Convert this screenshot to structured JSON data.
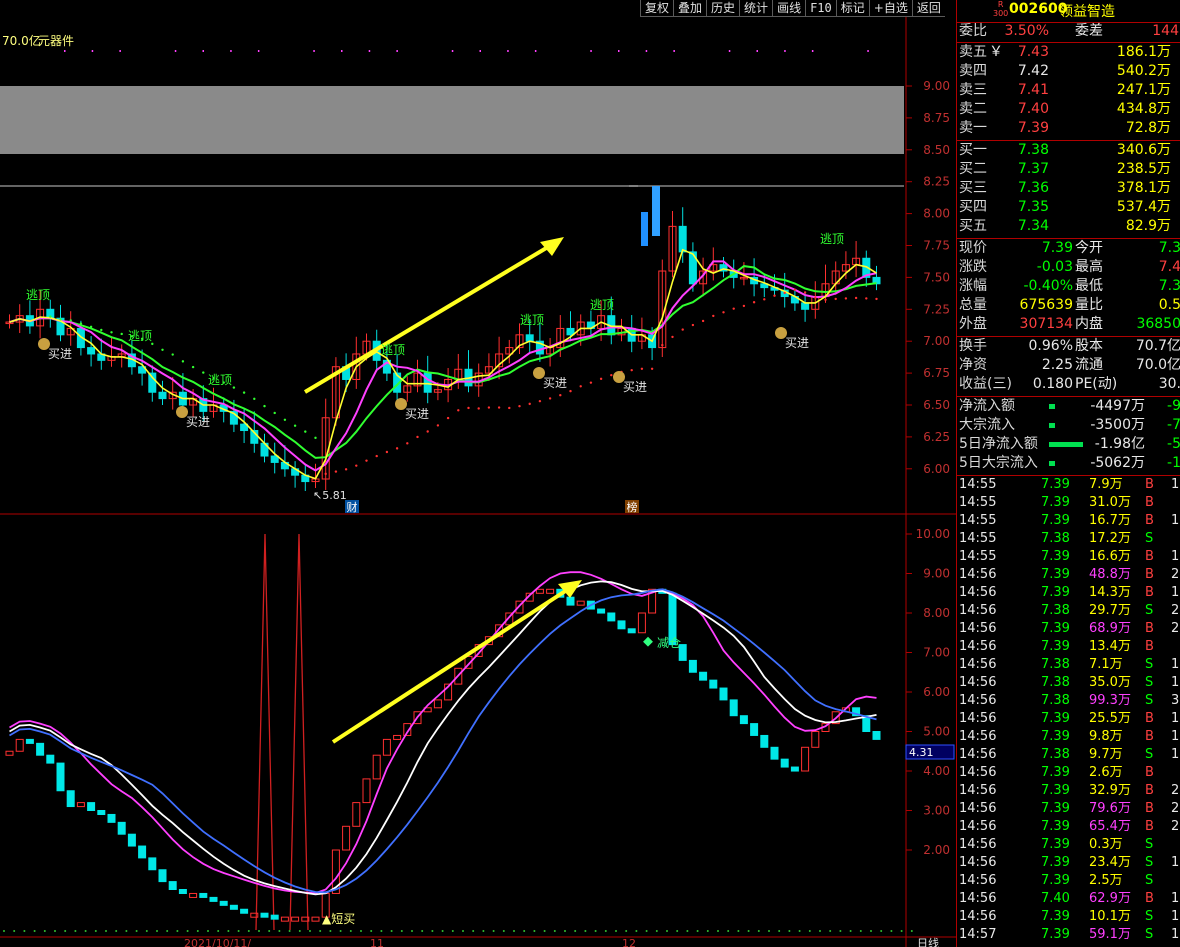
{
  "toolbar": {
    "buttons": [
      "复权",
      "叠加",
      "历史",
      "统计",
      "画线",
      "F10",
      "标记",
      "+自选",
      "返回"
    ]
  },
  "chart": {
    "top_text_a": "70.0亿",
    "top_text_b": "元器件",
    "main_axis": [
      "9.00",
      "8.75",
      "8.50",
      "8.25",
      "8.00",
      "7.75",
      "7.50",
      "7.25",
      "7.00",
      "6.75",
      "6.50",
      "6.25",
      "6.00"
    ],
    "low_label": "5.81",
    "labels": {
      "escape": "逃顶",
      "buy": "买进",
      "short_buy": "▲短买",
      "reduce": "减仓",
      "cai": "财",
      "bang": "榜"
    },
    "sub_axis": [
      "10.00",
      "9.00",
      "8.00",
      "7.00",
      "6.00",
      "5.00",
      "4.00",
      "3.00",
      "2.00"
    ],
    "sub_current": "4.31",
    "date_labels": [
      "2021/10/11/",
      "11",
      "12"
    ],
    "period": "日线"
  },
  "quote": {
    "badge_top": "R",
    "badge_bottom": "300",
    "code": "002600",
    "name": "领益智造",
    "weibi_label": "委比",
    "weibi": "3.50%",
    "weicha_label": "委差",
    "weicha": "144",
    "sell": [
      {
        "label": "卖五",
        "mark": "￥",
        "price": "7.43",
        "vol": "186.1万"
      },
      {
        "label": "卖四",
        "mark": "",
        "price": "7.42",
        "vol": "540.2万"
      },
      {
        "label": "卖三",
        "mark": "",
        "price": "7.41",
        "vol": "247.1万"
      },
      {
        "label": "卖二",
        "mark": "",
        "price": "7.40",
        "vol": "434.8万"
      },
      {
        "label": "卖一",
        "mark": "",
        "price": "7.39",
        "vol": "72.8万"
      }
    ],
    "buy": [
      {
        "label": "买一",
        "price": "7.38",
        "vol": "340.6万"
      },
      {
        "label": "买二",
        "price": "7.37",
        "vol": "238.5万"
      },
      {
        "label": "买三",
        "price": "7.36",
        "vol": "378.1万"
      },
      {
        "label": "买四",
        "price": "7.35",
        "vol": "537.4万"
      },
      {
        "label": "买五",
        "price": "7.34",
        "vol": "82.9万"
      }
    ],
    "stats": [
      {
        "l1": "现价",
        "v1": "7.39",
        "c1": "g",
        "l2": "今开",
        "v2": "7.3",
        "c2": "g"
      },
      {
        "l1": "涨跌",
        "v1": "-0.03",
        "c1": "g",
        "l2": "最高",
        "v2": "7.4",
        "c2": "r"
      },
      {
        "l1": "涨幅",
        "v1": "-0.40%",
        "c1": "g",
        "l2": "最低",
        "v2": "7.3",
        "c2": "g"
      },
      {
        "l1": "总量",
        "v1": "675639",
        "c1": "y",
        "l2": "量比",
        "v2": "0.5",
        "c2": "y"
      },
      {
        "l1": "外盘",
        "v1": "307134",
        "c1": "r",
        "l2": "内盘",
        "v2": "36850",
        "c2": "g"
      }
    ],
    "stats2": [
      {
        "l1": "换手",
        "v1": "0.96%",
        "l2": "股本",
        "v2": "70.7亿"
      },
      {
        "l1": "净资",
        "v1": "2.25",
        "l2": "流通",
        "v2": "70.0亿"
      },
      {
        "l1": "收益(三)",
        "v1": "0.180",
        "l2": "PE(动)",
        "v2": "30."
      }
    ],
    "flow": [
      {
        "label": "净流入额",
        "value": "-4497万",
        "extra": "-9",
        "bar": 6
      },
      {
        "label": "大宗流入",
        "value": "-3500万",
        "extra": "-7",
        "bar": 6
      },
      {
        "label": "5日净流入额",
        "value": "-1.98亿",
        "extra": "-5",
        "bar": 34
      },
      {
        "label": "5日大宗流入",
        "value": "-5062万",
        "extra": "-1",
        "bar": 6
      }
    ],
    "ticks": [
      {
        "t": "14:55",
        "p": "7.39",
        "v": "7.9万",
        "s": "B",
        "n": "1",
        "vc": "y"
      },
      {
        "t": "14:55",
        "p": "7.39",
        "v": "31.0万",
        "s": "B",
        "n": "",
        "vc": "y"
      },
      {
        "t": "14:55",
        "p": "7.39",
        "v": "16.7万",
        "s": "B",
        "n": "1",
        "vc": "y"
      },
      {
        "t": "14:55",
        "p": "7.38",
        "v": "17.2万",
        "s": "S",
        "n": "",
        "vc": "y"
      },
      {
        "t": "14:55",
        "p": "7.39",
        "v": "16.6万",
        "s": "B",
        "n": "1",
        "vc": "y"
      },
      {
        "t": "14:56",
        "p": "7.39",
        "v": "48.8万",
        "s": "B",
        "n": "2",
        "vc": "m"
      },
      {
        "t": "14:56",
        "p": "7.39",
        "v": "14.3万",
        "s": "B",
        "n": "1",
        "vc": "y"
      },
      {
        "t": "14:56",
        "p": "7.38",
        "v": "29.7万",
        "s": "S",
        "n": "2",
        "vc": "y"
      },
      {
        "t": "14:56",
        "p": "7.39",
        "v": "68.9万",
        "s": "B",
        "n": "2",
        "vc": "m"
      },
      {
        "t": "14:56",
        "p": "7.39",
        "v": "13.4万",
        "s": "B",
        "n": "",
        "vc": "y"
      },
      {
        "t": "14:56",
        "p": "7.38",
        "v": "7.1万",
        "s": "S",
        "n": "1",
        "vc": "y"
      },
      {
        "t": "14:56",
        "p": "7.38",
        "v": "35.0万",
        "s": "S",
        "n": "1",
        "vc": "y"
      },
      {
        "t": "14:56",
        "p": "7.38",
        "v": "99.3万",
        "s": "S",
        "n": "3",
        "vc": "m"
      },
      {
        "t": "14:56",
        "p": "7.39",
        "v": "25.5万",
        "s": "B",
        "n": "1",
        "vc": "y"
      },
      {
        "t": "14:56",
        "p": "7.39",
        "v": "9.8万",
        "s": "B",
        "n": "1",
        "vc": "y"
      },
      {
        "t": "14:56",
        "p": "7.38",
        "v": "9.7万",
        "s": "S",
        "n": "1",
        "vc": "y"
      },
      {
        "t": "14:56",
        "p": "7.39",
        "v": "2.6万",
        "s": "B",
        "n": "",
        "vc": "y"
      },
      {
        "t": "14:56",
        "p": "7.39",
        "v": "32.9万",
        "s": "B",
        "n": "2",
        "vc": "y"
      },
      {
        "t": "14:56",
        "p": "7.39",
        "v": "79.6万",
        "s": "B",
        "n": "2",
        "vc": "m"
      },
      {
        "t": "14:56",
        "p": "7.39",
        "v": "65.4万",
        "s": "B",
        "n": "2",
        "vc": "m"
      },
      {
        "t": "14:56",
        "p": "7.39",
        "v": "0.3万",
        "s": "S",
        "n": "",
        "vc": "y"
      },
      {
        "t": "14:56",
        "p": "7.39",
        "v": "23.4万",
        "s": "S",
        "n": "1",
        "vc": "y"
      },
      {
        "t": "14:56",
        "p": "7.39",
        "v": "2.5万",
        "s": "S",
        "n": "",
        "vc": "y"
      },
      {
        "t": "14:56",
        "p": "7.40",
        "v": "62.9万",
        "s": "B",
        "n": "1",
        "vc": "m"
      },
      {
        "t": "14:56",
        "p": "7.39",
        "v": "10.1万",
        "s": "S",
        "n": "1",
        "vc": "y"
      },
      {
        "t": "14:57",
        "p": "7.39",
        "v": "59.1万",
        "s": "S",
        "n": "1",
        "vc": "m"
      }
    ]
  }
}
